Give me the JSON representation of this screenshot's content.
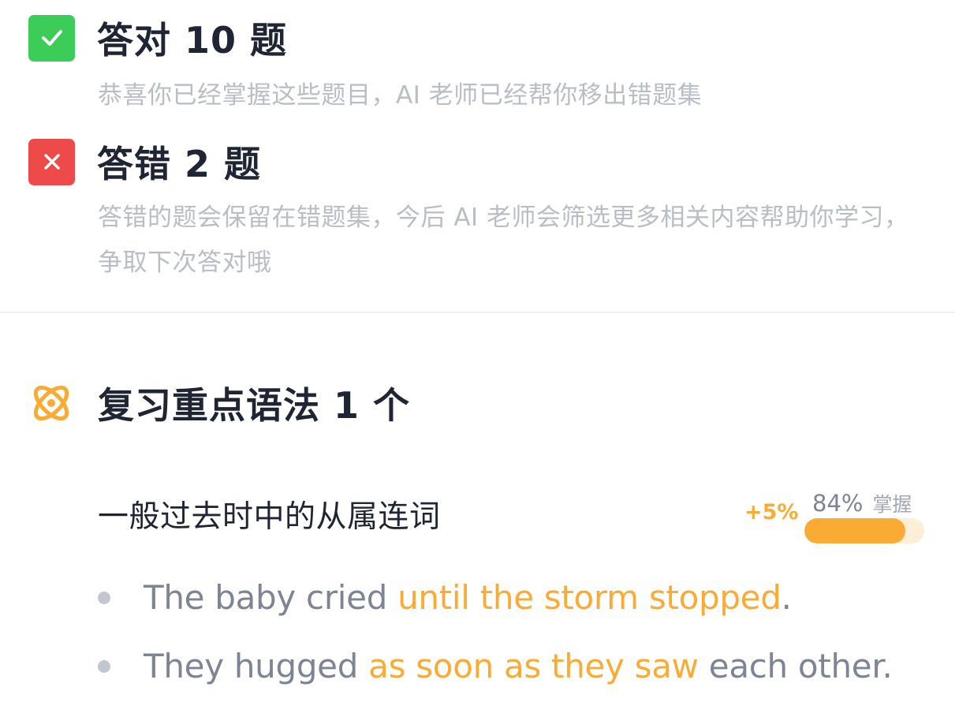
{
  "correct": {
    "title": "答对 10 题",
    "description": "恭喜你已经掌握这些题目，AI 老师已经帮你移出错题集",
    "icon": "checkmark-icon",
    "color": "#3ccd58"
  },
  "wrong": {
    "title": "答错 2 题",
    "description": "答错的题会保留在错题集，今后 AI 老师会筛选更多相关内容帮助你学习，争取下次答对哦",
    "icon": "close-icon",
    "color": "#ef4a4a"
  },
  "review": {
    "title": "复习重点语法 1 个",
    "icon": "grammar-flower-icon",
    "accent_color": "#f9ab33",
    "grammar": {
      "name": "一般过去时中的从属连词",
      "gain": "+5%",
      "mastery_percent": "84%",
      "mastery_label": "掌握",
      "mastery_value": 0.84
    },
    "examples": [
      {
        "before": "The baby cried ",
        "highlight": "until the storm stopped",
        "after": "."
      },
      {
        "before": "They hugged ",
        "highlight": "as soon as they saw",
        "after": " each other."
      }
    ]
  }
}
